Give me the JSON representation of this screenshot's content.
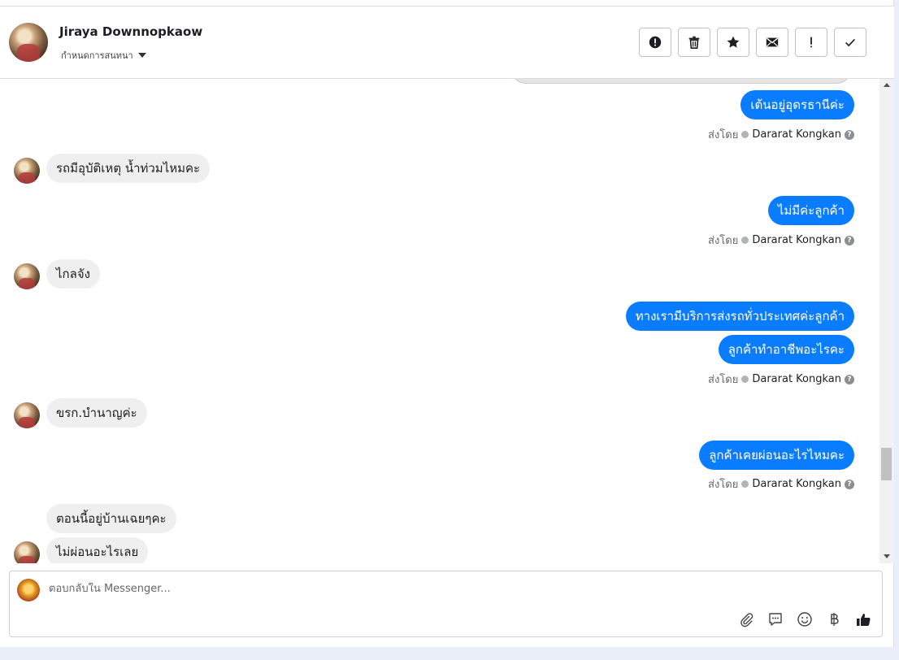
{
  "header": {
    "name": "Jiraya Downnopkaow",
    "subtitle": "กำหนดการสนทนา"
  },
  "actions": [
    {
      "name": "spam-button",
      "icon": "alert-circle-icon"
    },
    {
      "name": "delete-button",
      "icon": "trash-icon"
    },
    {
      "name": "star-button",
      "icon": "star-icon"
    },
    {
      "name": "mark-unread-button",
      "icon": "envelope-icon"
    },
    {
      "name": "follow-up-button",
      "icon": "exclamation-icon"
    },
    {
      "name": "mark-done-button",
      "icon": "check-icon"
    }
  ],
  "messages": [
    {
      "dir": "out",
      "text": "เต้นอยู่อุดรธานีค่ะ"
    },
    {
      "dir": "sent_by",
      "prefix": "ส่งโดย",
      "agent": "Dararat Kongkan"
    },
    {
      "dir": "in",
      "text": "รถมีอุบัติเหตุ น้ำท่วมไหมคะ"
    },
    {
      "dir": "out",
      "text": "ไม่มีค่ะลูกค้า"
    },
    {
      "dir": "sent_by",
      "prefix": "ส่งโดย",
      "agent": "Dararat Kongkan"
    },
    {
      "dir": "in",
      "text": "ไกลจัง"
    },
    {
      "dir": "out",
      "text": "ทางเรามีบริการส่งรถทั่วประเทศค่ะลูกค้า"
    },
    {
      "dir": "out",
      "text": "ลูกค้าทำอาชีพอะไรคะ"
    },
    {
      "dir": "sent_by",
      "prefix": "ส่งโดย",
      "agent": "Dararat Kongkan"
    },
    {
      "dir": "in",
      "text": "ขรก.บำนาญค่ะ"
    },
    {
      "dir": "out",
      "text": "ลูกค้าเคยผ่อนอะไรไหมคะ"
    },
    {
      "dir": "sent_by",
      "prefix": "ส่งโดย",
      "agent": "Dararat Kongkan"
    },
    {
      "dir": "in",
      "text": "ตอนนี้อยู่บ้านเฉยๆคะ"
    },
    {
      "dir": "in",
      "text": "ไม่ผ่อนอะไรเลย"
    }
  ],
  "composer": {
    "placeholder": "ตอบกลับใน Messenger...",
    "tools": [
      "paperclip-icon",
      "quick-reply-icon",
      "emoji-icon",
      "baht-icon",
      "thumbs-up-icon"
    ]
  }
}
